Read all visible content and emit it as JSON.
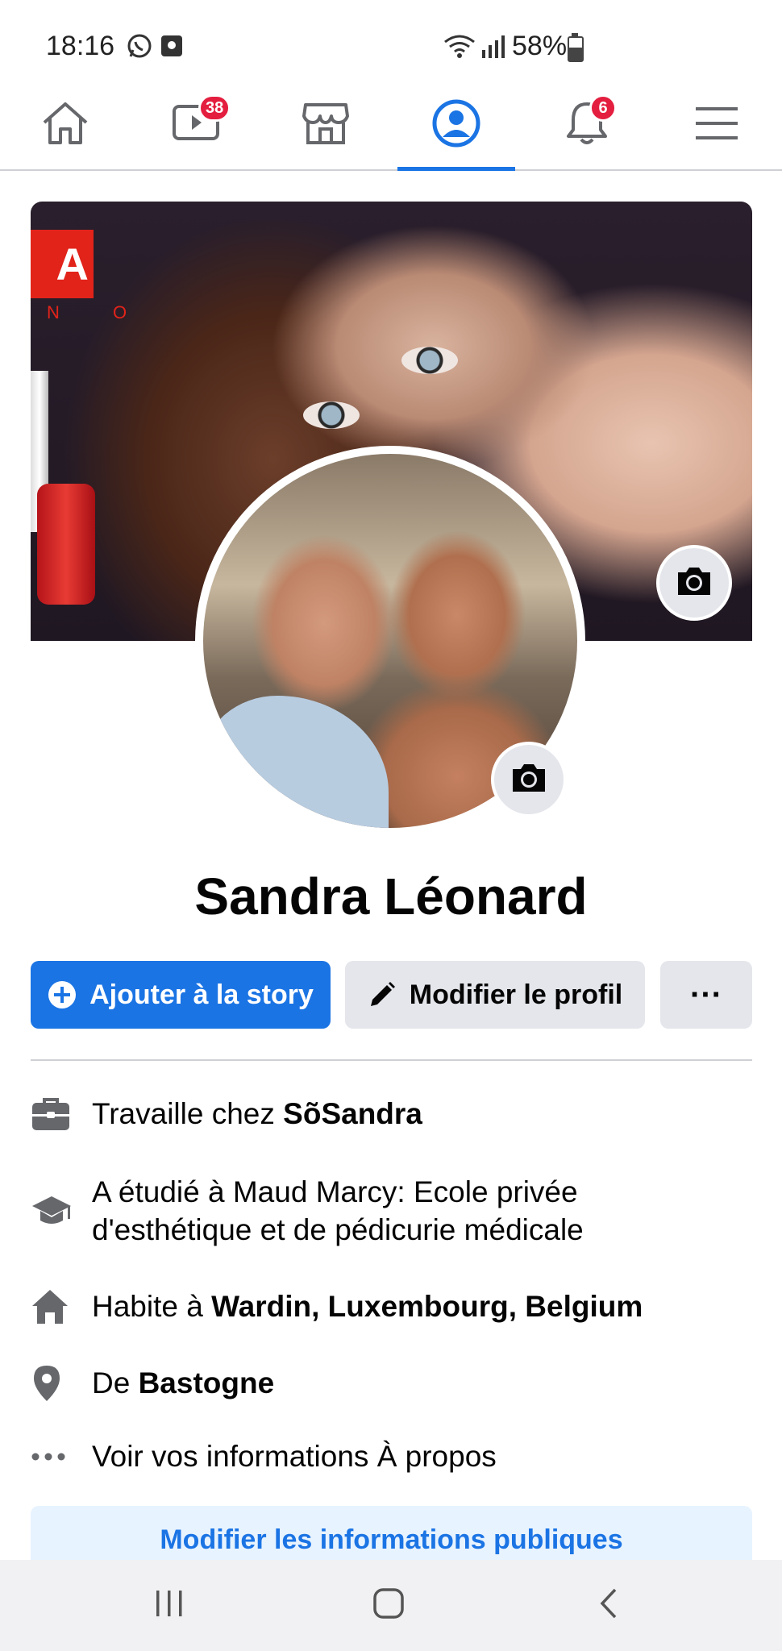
{
  "status_bar": {
    "time": "18:16",
    "battery": "58%",
    "battery_level": 0.58
  },
  "nav": {
    "items": [
      {
        "name": "home",
        "icon": "home-icon"
      },
      {
        "name": "watch",
        "icon": "video-icon",
        "badge": "38"
      },
      {
        "name": "marketplace",
        "icon": "store-icon"
      },
      {
        "name": "profile",
        "icon": "profile-icon",
        "active": true
      },
      {
        "name": "notifications",
        "icon": "bell-icon",
        "badge": "6"
      },
      {
        "name": "menu",
        "icon": "hamburger-menu-icon"
      }
    ]
  },
  "cover": {
    "brand_logo_text": "A",
    "brand_sub_text": "N O"
  },
  "profile": {
    "name": "Sandra Léonard"
  },
  "actions": {
    "add_story": "Ajouter à la story",
    "edit_profile": "Modifier le profil",
    "more": "···"
  },
  "intro": {
    "work_prefix": "Travaille chez ",
    "work_value": "SõSandra",
    "studied_line1": "A étudié à Maud Marcy: Ecole privée",
    "studied_line2": "d'esthétique et de pédicurie médicale",
    "lives_prefix": "Habite à ",
    "lives_value": "Wardin, Luxembourg, Belgium",
    "from_prefix": "De ",
    "from_value": "Bastogne",
    "about_link": "Voir vos informations À propos"
  },
  "public_info_button": "Modifier les informations publiques",
  "colors": {
    "accent": "#1b74e4",
    "badge": "#e41e3f",
    "button_gray": "#e4e6eb",
    "public_btn_bg": "#e7f3ff"
  }
}
